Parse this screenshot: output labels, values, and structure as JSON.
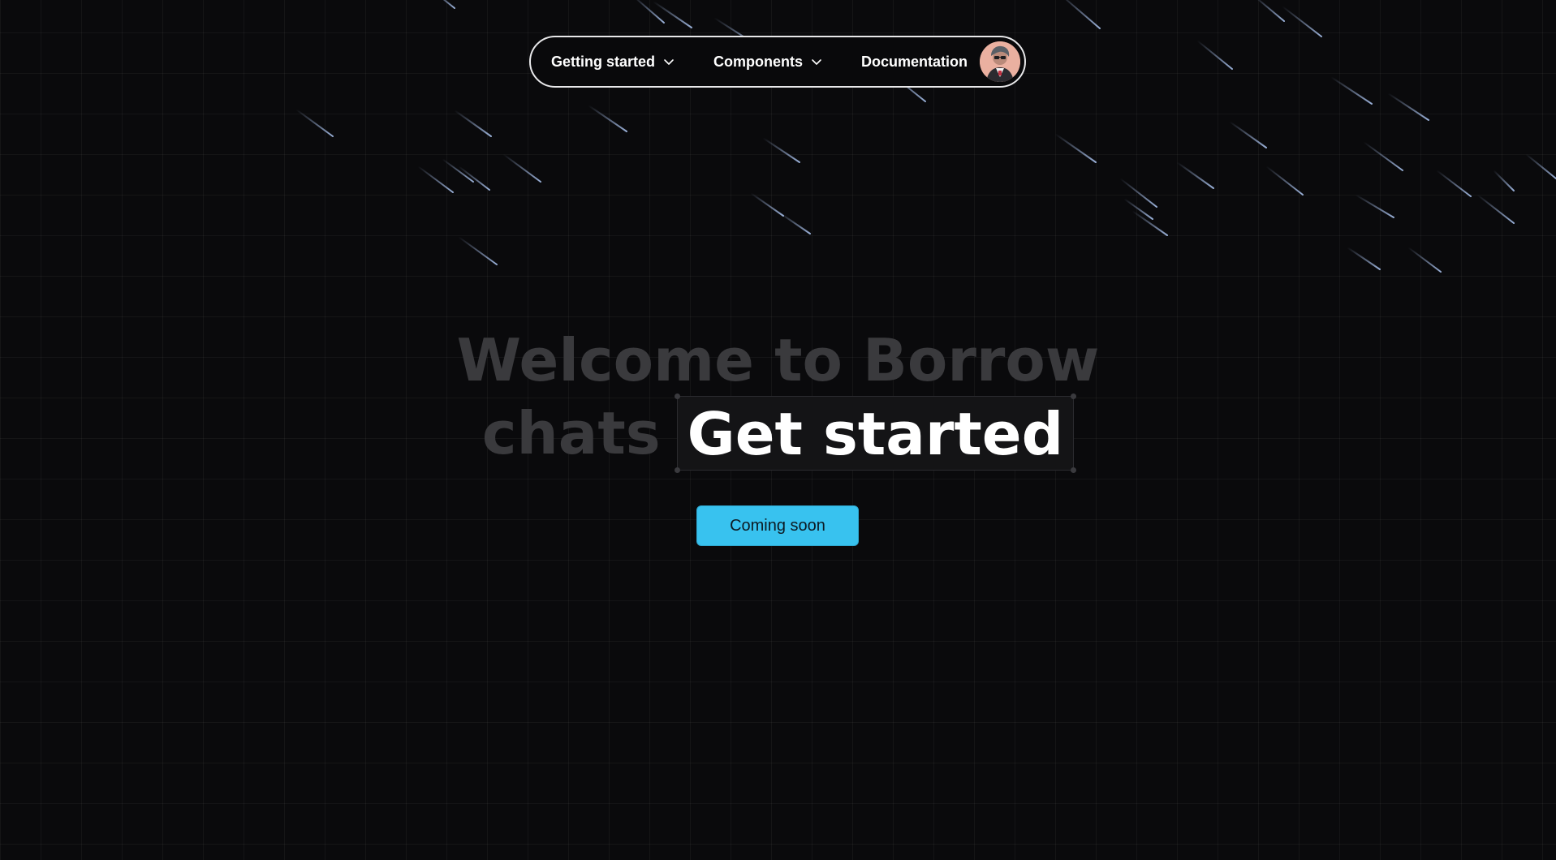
{
  "nav": {
    "items": [
      {
        "label": "Getting started",
        "has_dropdown": true
      },
      {
        "label": "Components",
        "has_dropdown": true
      },
      {
        "label": "Documentation",
        "has_dropdown": false
      }
    ],
    "avatar_icon": "user-avatar"
  },
  "hero": {
    "line1": "Welcome to Borrow",
    "line2_prefix": "chats",
    "highlight": "Get started"
  },
  "cta": {
    "label": "Coming soon"
  },
  "colors": {
    "background": "#0a0a0c",
    "accent": "#38c2ef",
    "muted_text": "#3a3a3d",
    "nav_border": "#e8e8ea"
  }
}
